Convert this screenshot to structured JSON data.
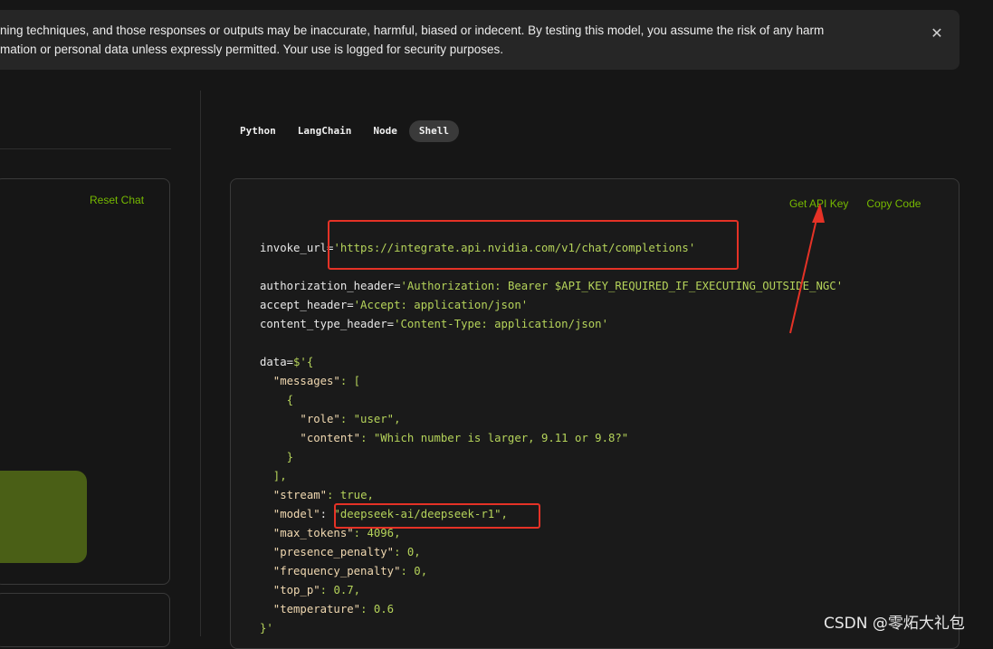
{
  "banner": {
    "line1": "ning techniques, and those responses or outputs may be inaccurate, harmful, biased or indecent. By testing this model, you assume the risk of any harm",
    "line2": "mation or personal data unless expressly permitted. Your use is logged for security purposes.",
    "close_icon": "close-icon"
  },
  "chat": {
    "reset_label": "Reset Chat"
  },
  "tabs": [
    {
      "label": "Python",
      "active": false
    },
    {
      "label": "LangChain",
      "active": false
    },
    {
      "label": "Node",
      "active": false
    },
    {
      "label": "Shell",
      "active": true
    }
  ],
  "code_actions": {
    "get_api_key": "Get API Key",
    "copy_code": "Copy Code"
  },
  "code": {
    "invoke_url_var": "invoke_url=",
    "invoke_url_val": "'https://integrate.api.nvidia.com/v1/chat/completions'",
    "auth_var": "authorization_header=",
    "auth_val": "'Authorization: Bearer $API_KEY_REQUIRED_IF_EXECUTING_OUTSIDE_NGC'",
    "accept_var": "accept_header=",
    "accept_val": "'Accept: application/json'",
    "ctype_var": "content_type_header=",
    "ctype_val": "'Content-Type: application/json'",
    "data_open_var": "data=",
    "data_open_val": "$'{",
    "messages_key": "  \"messages\"",
    "messages_open": ": [",
    "obj_open": "    {",
    "role_key": "      \"role\"",
    "role_val": ": \"user\",",
    "content_key": "      \"content\"",
    "content_val": ": \"Which number is larger, 9.11 or 9.8?\"",
    "obj_close": "    }",
    "messages_close": "  ],",
    "stream_key": "  \"stream\"",
    "stream_val": ": true,",
    "model_key": "  \"model\"",
    "model_sep": ": ",
    "model_val": "\"deepseek-ai/deepseek-r1\",",
    "max_tokens_key": "  \"max_tokens\"",
    "max_tokens_val": ": 4096,",
    "presence_key": "  \"presence_penalty\"",
    "presence_val": ": 0,",
    "frequency_key": "  \"frequency_penalty\"",
    "frequency_val": ": 0,",
    "top_p_key": "  \"top_p\"",
    "top_p_val": ": 0.7,",
    "temperature_key": "  \"temperature\"",
    "temperature_val": ": 0.6",
    "data_close": "}'"
  },
  "annotations": {
    "color": "#e53226"
  },
  "watermark": "CSDN @零炻大礼包",
  "colors": {
    "accent": "#76b900",
    "background": "#161616",
    "panel": "#262626"
  }
}
